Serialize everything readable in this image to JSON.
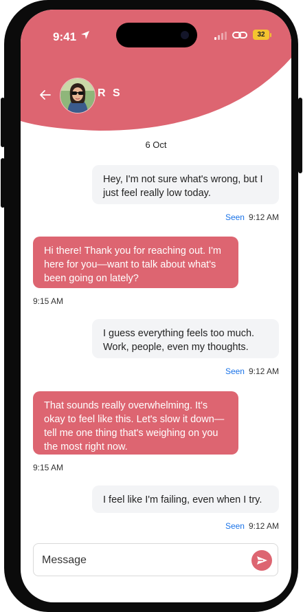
{
  "status_bar": {
    "time": "9:41",
    "battery": "32"
  },
  "contact": {
    "name": "R S"
  },
  "date_separator": "6 Oct",
  "messages": [
    {
      "direction": "out",
      "lines": [
        "Hey, I'm not sure what's wrong, but I",
        "just feel really low today."
      ],
      "seen_label": "Seen",
      "time": "9:12 AM"
    },
    {
      "direction": "in",
      "lines": [
        "Hi there! Thank you for reaching out. I'm",
        "here for you—want to talk about what's",
        "been going on lately?"
      ],
      "time": "9:15 AM"
    },
    {
      "direction": "out",
      "lines": [
        "I guess everything feels too much.",
        "Work, people, even my thoughts."
      ],
      "seen_label": "Seen",
      "time": "9:12 AM"
    },
    {
      "direction": "in",
      "lines": [
        "That sounds really overwhelming. It's",
        "okay to feel like this. Let's slow it down—",
        "tell me one thing that's weighing on you",
        "the most right now."
      ],
      "time": "9:15 AM"
    },
    {
      "direction": "out",
      "lines": [
        "I feel like I'm failing, even when I try."
      ],
      "seen_label": "Seen",
      "time": "9:12 AM"
    }
  ],
  "composer": {
    "placeholder": "Message"
  },
  "colors": {
    "accent": "#dd6571",
    "seen": "#1a73e8",
    "outgoing_bubble": "#f3f4f6"
  }
}
